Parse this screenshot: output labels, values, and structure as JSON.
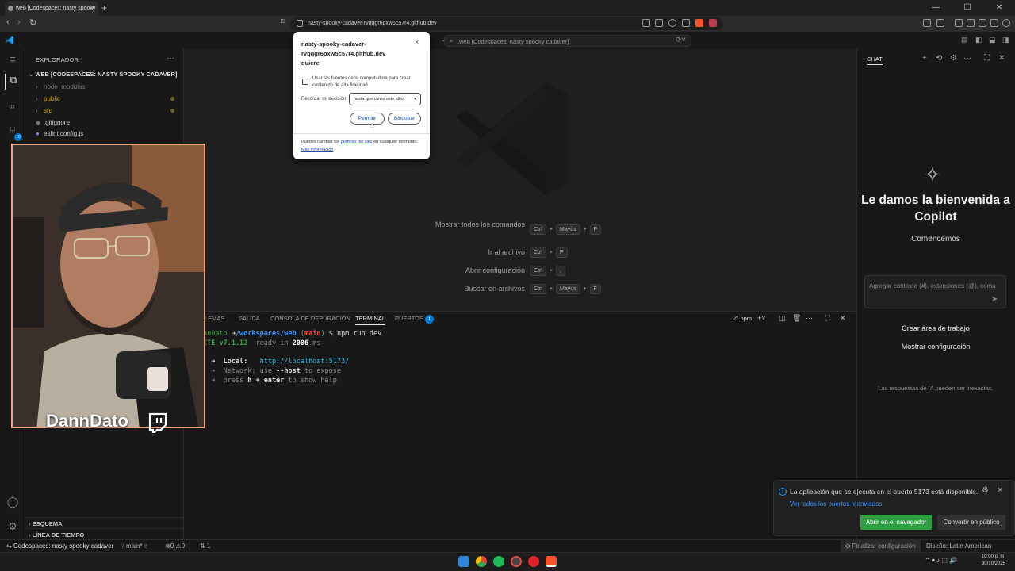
{
  "browser": {
    "tab_title": "web [Codespaces: nasty spooky",
    "url": "nasty-spooky-cadaver-rvqqgr6pxw5c57r4.github.dev"
  },
  "vscode": {
    "command_center": "web [Codespaces: nasty spooky cadaver]",
    "sidebar": {
      "title": "EXPLORADOR",
      "root": "WEB [CODESPACES: NASTY SPOOKY CADAVER]",
      "items": [
        {
          "label": "node_modules",
          "color": "#7a7a7a"
        },
        {
          "label": "public",
          "color": "#cca700"
        },
        {
          "label": "src",
          "color": "#cca700"
        },
        {
          "label": ".gitignore",
          "color": "#cccccc"
        },
        {
          "label": "eslint.config.js",
          "color": "#cccccc"
        }
      ],
      "source_control_badge": "10",
      "outline": "ESQUEMA",
      "timeline": "LÍNEA DE TIEMPO"
    },
    "editor": {
      "shortcuts": [
        {
          "label": "Mostrar todos los comandos",
          "keys": [
            "Ctrl",
            "+",
            "Mayús",
            "+",
            "P"
          ]
        },
        {
          "label": "Ir al archivo",
          "keys": [
            "Ctrl",
            "+",
            "P"
          ]
        },
        {
          "label": "Abrir configuración",
          "keys": [
            "Ctrl",
            "+",
            ","
          ]
        },
        {
          "label": "Buscar en archivos",
          "keys": [
            "Ctrl",
            "+",
            "Mayús",
            "+",
            "F"
          ]
        }
      ]
    },
    "panel": {
      "tabs": {
        "problems": "LEMAS",
        "output": "SALIDA",
        "debug": "CONSOLA DE DEPURACIÓN",
        "terminal": "TERMINAL",
        "ports": "PUERTOS",
        "ports_badge": "1"
      },
      "terminal_name": "npm",
      "prompt": {
        "user": "nnDato",
        "arrow": " ➜",
        "path": "/workspaces/web",
        "branch_open": " (",
        "branch": "main",
        "branch_close": ")",
        "cmd": " $ npm run dev"
      },
      "vite": {
        "name": "ITE v7.1.12",
        "ready": "  ready in ",
        "ms": "2006",
        "ms_unit": " ms"
      },
      "local_label": "  ➜  Local:   ",
      "local_url": "http://localhost:5173/",
      "network_line": "  ➜  Network: use ",
      "network_flag": "--host",
      "network_end": " to expose",
      "help_line": "  ➜  press ",
      "help_key": "h + enter",
      "help_end": " to show help"
    },
    "chat": {
      "title": "CHAT",
      "welcome": "Le damos la bienvenida a Copilot",
      "begin": "Comencemos",
      "input_placeholder": "Agregar contexto (#), extensiones (@), coma",
      "link_workspace": "Crear área de trabajo",
      "link_settings": "Mostrar configuración",
      "disclaimer": "Las respuestas de IA pueden ser inexactas."
    },
    "notification": {
      "message": "La aplicación que se ejecuta en el puerto 5173 está disponible.",
      "link": "Ver todos los puertos reenviados",
      "open_button": "Abrir en el navegador",
      "public_button": "Convertir en público"
    },
    "status": {
      "remote": "Codespaces: nasty spooky cadaver",
      "branch": "main*",
      "errors": "0",
      "warnings": "0",
      "ports": "1",
      "finish_setup": "Finalizar configuración",
      "theme": "Diseño: Latin American"
    }
  },
  "permission_popup": {
    "title": "nasty-spooky-cadaver-rvqqgr6pxw5c57r4.github.dev quiere",
    "description": "Usar las fuentes de la computadora para crear contenido de alta fidelidad",
    "remember_label": "Recordar mi decisión",
    "remember_value": "hasta que cierre este sitio",
    "allow": "Permitir",
    "block": "Bloquear",
    "footer_pre": "Puedes cambiar los ",
    "footer_link": "permiso del sitio",
    "footer_mid": " en cualquier momento. ",
    "footer_more": "Más información"
  },
  "webcam": {
    "streamer_name": "DannDato"
  },
  "taskbar": {
    "time": "10:00 p. m.",
    "date": "30/10/2025"
  },
  "colors": {
    "accent": "#0078d4",
    "webcam_border": "#f2a37f",
    "success_button": "#2ea043"
  }
}
